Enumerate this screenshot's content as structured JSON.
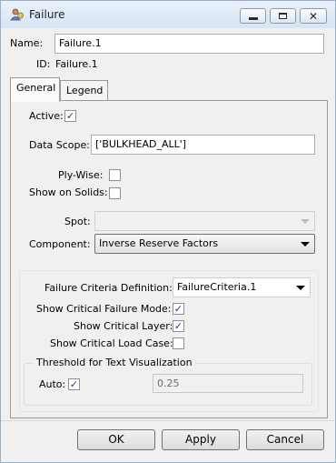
{
  "window": {
    "title": "Failure",
    "icon": "failure-app-icon"
  },
  "header": {
    "name_label": "Name:",
    "name_value": "Failure.1",
    "id_label": "ID:",
    "id_value": "Failure.1"
  },
  "tabs": [
    {
      "label": "General",
      "active": true
    },
    {
      "label": "Legend",
      "active": false
    }
  ],
  "general": {
    "active_label": "Active:",
    "active_checked": true,
    "data_scope_label": "Data Scope:",
    "data_scope_value": "['BULKHEAD_ALL']",
    "ply_wise_label": "Ply-Wise:",
    "show_on_solids_label": "Show on Solids:",
    "spot_label": "Spot:",
    "spot_value": "",
    "component_label": "Component:",
    "component_value": "Inverse Reserve Factors"
  },
  "criteria": {
    "definition_label": "Failure Criteria Definition:",
    "definition_value": "FailureCriteria.1",
    "critical_mode_label": "Show Critical Failure Mode:",
    "critical_mode_checked": true,
    "critical_layer_label": "Show Critical Layer:",
    "critical_layer_checked": true,
    "critical_load_case_label": "Show Critical Load Case:",
    "critical_load_case_checked": false
  },
  "threshold": {
    "title": "Threshold for Text Visualization",
    "auto_label": "Auto:",
    "auto_checked": true,
    "value": "0.25"
  },
  "buttons": {
    "ok": "OK",
    "apply": "Apply",
    "cancel": "Cancel"
  },
  "colors": {
    "title_bar": "#dde8f5",
    "check_mark": "#1c3e8a",
    "dialog_bg": "#f0f0f0"
  }
}
